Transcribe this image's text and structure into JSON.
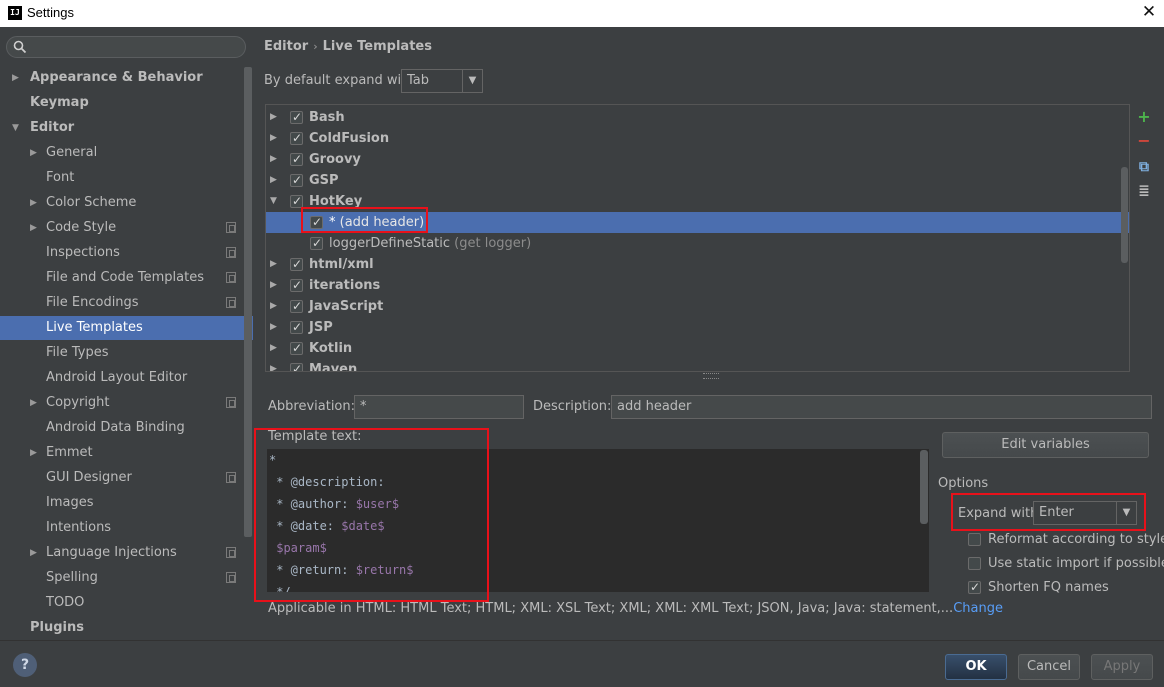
{
  "window": {
    "title": "Settings",
    "app_icon": "IJ",
    "close_glyph": "✕"
  },
  "sidebar": {
    "search_placeholder": "",
    "items": [
      {
        "label": "Appearance & Behavior",
        "arrow": "▶",
        "bold": true
      },
      {
        "label": "Keymap",
        "arrow": "",
        "bold": true
      },
      {
        "label": "Editor",
        "arrow": "▼",
        "bold": true
      },
      {
        "label": "General",
        "arrow": "▶"
      },
      {
        "label": "Font",
        "arrow": ""
      },
      {
        "label": "Color Scheme",
        "arrow": "▶"
      },
      {
        "label": "Code Style",
        "arrow": "▶",
        "project": true
      },
      {
        "label": "Inspections",
        "arrow": "",
        "project": true
      },
      {
        "label": "File and Code Templates",
        "arrow": "",
        "project": true
      },
      {
        "label": "File Encodings",
        "arrow": "",
        "project": true
      },
      {
        "label": "Live Templates",
        "arrow": "",
        "selected": true
      },
      {
        "label": "File Types",
        "arrow": ""
      },
      {
        "label": "Android Layout Editor",
        "arrow": ""
      },
      {
        "label": "Copyright",
        "arrow": "▶",
        "project": true
      },
      {
        "label": "Android Data Binding",
        "arrow": ""
      },
      {
        "label": "Emmet",
        "arrow": "▶"
      },
      {
        "label": "GUI Designer",
        "arrow": "",
        "project": true
      },
      {
        "label": "Images",
        "arrow": ""
      },
      {
        "label": "Intentions",
        "arrow": ""
      },
      {
        "label": "Language Injections",
        "arrow": "▶",
        "project": true
      },
      {
        "label": "Spelling",
        "arrow": "",
        "project": true
      },
      {
        "label": "TODO",
        "arrow": ""
      },
      {
        "label": "Plugins",
        "arrow": "",
        "bold": true
      }
    ]
  },
  "breadcrumb": {
    "parent": "Editor",
    "sep": "›",
    "current": "Live Templates"
  },
  "expand_default": {
    "label": "By default expand with",
    "value": "Tab",
    "dd": "▼"
  },
  "template_groups": [
    {
      "label": "Bash",
      "arrow": "▶",
      "group": true
    },
    {
      "label": "ColdFusion",
      "arrow": "▶",
      "group": true
    },
    {
      "label": "Groovy",
      "arrow": "▶",
      "group": true
    },
    {
      "label": "GSP",
      "arrow": "▶",
      "group": true
    },
    {
      "label": "HotKey",
      "arrow": "▼",
      "group": true
    },
    {
      "label": "*",
      "desc": "(add header)",
      "arrow": "",
      "child": true,
      "selected": true
    },
    {
      "label": "loggerDefineStatic",
      "desc": "(get logger)",
      "arrow": "",
      "child": true
    },
    {
      "label": "html/xml",
      "arrow": "▶",
      "group": true
    },
    {
      "label": "iterations",
      "arrow": "▶",
      "group": true
    },
    {
      "label": "JavaScript",
      "arrow": "▶",
      "group": true
    },
    {
      "label": "JSP",
      "arrow": "▶",
      "group": true
    },
    {
      "label": "Kotlin",
      "arrow": "▶",
      "group": true
    },
    {
      "label": "Maven",
      "arrow": "▶",
      "group": true
    }
  ],
  "tools": {
    "add": "+",
    "remove": "−",
    "copy": "⧉",
    "text": "≣"
  },
  "abbreviation": {
    "label": "Abbreviation:",
    "value": "*"
  },
  "description": {
    "label": "Description:",
    "value": "add header"
  },
  "template_text": {
    "label": "Template text:",
    "lines": [
      [
        [
          "*",
          ""
        ]
      ],
      [
        [
          " * @description:",
          ""
        ]
      ],
      [
        [
          " * @author: ",
          ""
        ],
        [
          "$user$",
          "var"
        ]
      ],
      [
        [
          " * @date: ",
          ""
        ],
        [
          "$date$",
          "var"
        ]
      ],
      [
        [
          " ",
          ""
        ],
        [
          "$param$",
          "var"
        ]
      ],
      [
        [
          " * @return: ",
          ""
        ],
        [
          "$return$",
          "var"
        ]
      ],
      [
        [
          " */",
          ""
        ]
      ]
    ]
  },
  "edit_variables": "Edit variables",
  "options": {
    "title": "Options",
    "expand_with_label": "Expand with",
    "expand_with_value": "Enter",
    "reformat": "Reformat according to style",
    "static_import": "Use static import if possible",
    "shorten_fq": "Shorten FQ names"
  },
  "applicable": {
    "text": "Applicable in HTML: HTML Text; HTML; XML: XSL Text; XML; XML: XML Text; JSON, Java; Java: statement,...",
    "change": "Change"
  },
  "buttons": {
    "ok": "OK",
    "cancel": "Cancel",
    "apply": "Apply",
    "help": "?"
  },
  "highlight_color": "#e8111a",
  "accent_selection": "#4b6eaf"
}
